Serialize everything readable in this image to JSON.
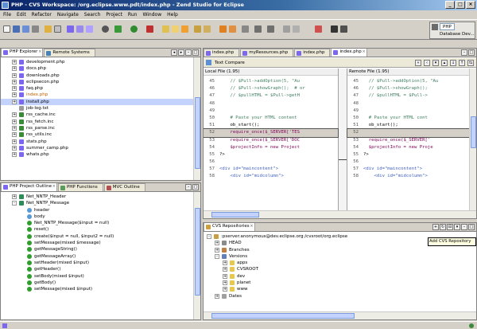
{
  "window": {
    "title": "PHP - CVS Workspace: /org.eclipse.www.pdt/index.php - Zend Studio for Eclipse",
    "buttons": [
      "_",
      "□",
      "×"
    ]
  },
  "menu": [
    "File",
    "Edit",
    "Refactor",
    "Navigate",
    "Search",
    "Project",
    "Run",
    "Window",
    "Help"
  ],
  "perspective": {
    "active": "PHP",
    "other": "Database Dev..."
  },
  "explorer": {
    "tabs": [
      "PHP Explorer",
      "Remote Systems"
    ],
    "items": [
      {
        "label": "development.php",
        "type": "php",
        "exp": true
      },
      {
        "label": "docs.php",
        "type": "php",
        "exp": true
      },
      {
        "label": "downloads.php",
        "type": "php",
        "exp": true
      },
      {
        "label": "eclipsecon.php",
        "type": "php",
        "exp": true
      },
      {
        "label": "faq.php",
        "type": "php",
        "exp": true
      },
      {
        "label": "index.php",
        "type": "php",
        "exp": true,
        "highlight": true
      },
      {
        "label": "install.php",
        "type": "php",
        "exp": true,
        "selected": true
      },
      {
        "label": "job-log.txt",
        "type": "txt",
        "exp": false
      },
      {
        "label": "rss_cache.inc",
        "type": "inc",
        "exp": true
      },
      {
        "label": "rss_fetch.inc",
        "type": "inc",
        "exp": true
      },
      {
        "label": "rss_parse.inc",
        "type": "inc",
        "exp": true
      },
      {
        "label": "rss_utils.inc",
        "type": "inc",
        "exp": true
      },
      {
        "label": "stats.php",
        "type": "php",
        "exp": true
      },
      {
        "label": "summer_camp.php",
        "type": "php",
        "exp": true
      },
      {
        "label": "whats.php",
        "type": "php",
        "exp": true
      }
    ]
  },
  "outline": {
    "tabs": [
      "PHP Project Outline",
      "PHP Functions",
      "MVC Outline"
    ],
    "items": [
      {
        "label": "Net_NNTP_Header",
        "depth": 0,
        "type": "class",
        "exp": "+"
      },
      {
        "label": "Net_NNTP_Message",
        "depth": 0,
        "type": "class",
        "exp": "-"
      },
      {
        "label": "header",
        "depth": 1,
        "type": "field"
      },
      {
        "label": "body",
        "depth": 1,
        "type": "field"
      },
      {
        "label": "Net_NNTP_Message($input = null)",
        "depth": 1,
        "type": "method"
      },
      {
        "label": "reset()",
        "depth": 1,
        "type": "method"
      },
      {
        "label": "create($input = null, $input2 = null)",
        "depth": 1,
        "type": "method"
      },
      {
        "label": "setMessage(mixed $message)",
        "depth": 1,
        "type": "method"
      },
      {
        "label": "getMessageString()",
        "depth": 1,
        "type": "method"
      },
      {
        "label": "getMessageArray()",
        "depth": 1,
        "type": "method"
      },
      {
        "label": "setHeader(mixed $input)",
        "depth": 1,
        "type": "method"
      },
      {
        "label": "getHeader()",
        "depth": 1,
        "type": "method"
      },
      {
        "label": "setBody(mixed $input)",
        "depth": 1,
        "type": "method"
      },
      {
        "label": "getBody()",
        "depth": 1,
        "type": "method"
      },
      {
        "label": "setMessage(mixed $input)",
        "depth": 1,
        "type": "method"
      }
    ]
  },
  "editor": {
    "tabs": [
      "index.php",
      "myResources.php",
      "index.php",
      "index.php"
    ],
    "compare_tab": "Text Compare",
    "local_label": "Local File (1.95)",
    "remote_label": "Remote File (1.95)",
    "left_lines": [
      {
        "n": "45",
        "t": "    // $Pull->addOption(5, \"Au"
      },
      {
        "n": "46",
        "t": "    // $Pull->showGraph();  # or"
      },
      {
        "n": "47",
        "t": "    // $pullHTML = $Pull->getH"
      },
      {
        "n": "48",
        "t": ""
      },
      {
        "n": "49",
        "t": ""
      },
      {
        "n": "50",
        "t": "    # Paste your HTML content"
      },
      {
        "n": "51",
        "t": "    ob_start();"
      },
      {
        "n": "52",
        "t": "    require_once($_SERVER['TES"
      },
      {
        "n": "53",
        "t": "    require_once($_SERVER['DOC"
      },
      {
        "n": "54",
        "t": "    $projectInfo = new Project"
      },
      {
        "n": "55",
        "t": "?>"
      },
      {
        "n": "56",
        "t": ""
      },
      {
        "n": "57",
        "t": "<div id=\"maincontent\">"
      },
      {
        "n": "58",
        "t": "    <div id=\"midcolumn\">"
      }
    ],
    "right_lines": [
      {
        "n": "45",
        "t": "  // $Pull->addOption(5, \"Au"
      },
      {
        "n": "46",
        "t": "  // $Pull->showGraph();"
      },
      {
        "n": "47",
        "t": "  // $pullHTML = $Pull->"
      },
      {
        "n": "48",
        "t": ""
      },
      {
        "n": "49",
        "t": ""
      },
      {
        "n": "50",
        "t": "  # Paste your HTML cont"
      },
      {
        "n": "51",
        "t": "  ob_start();"
      },
      {
        "n": "52",
        "t": ""
      },
      {
        "n": "53",
        "t": "  require_once($_SERVER['"
      },
      {
        "n": "54",
        "t": "  $projectInfo = new Proje"
      },
      {
        "n": "55",
        "t": "?>"
      },
      {
        "n": "56",
        "t": ""
      },
      {
        "n": "57",
        "t": "<div id=\"maincontent\">"
      },
      {
        "n": "58",
        "t": "    <div id=\"midcolumn\">"
      }
    ]
  },
  "cvs": {
    "tab": "CVS Repositories",
    "tooltip": "Add CVS Repository",
    "items": [
      {
        "label": ":pserver:anonymous@dev.eclipse.org:/cvsroot/org.eclipse",
        "depth": 0,
        "type": "repo",
        "exp": "-"
      },
      {
        "label": "HEAD",
        "depth": 1,
        "type": "head",
        "exp": "+"
      },
      {
        "label": "Branches",
        "depth": 1,
        "type": "branch",
        "exp": "+"
      },
      {
        "label": "Versions",
        "depth": 1,
        "type": "version",
        "exp": "-"
      },
      {
        "label": "apps",
        "depth": 2,
        "type": "folder",
        "exp": "+"
      },
      {
        "label": "CVSROOT",
        "depth": 2,
        "type": "folder",
        "exp": "+"
      },
      {
        "label": "dev",
        "depth": 2,
        "type": "folder",
        "exp": "+"
      },
      {
        "label": "planet",
        "depth": 2,
        "type": "folder",
        "exp": "+"
      },
      {
        "label": "www",
        "depth": 2,
        "type": "folder",
        "exp": "+"
      },
      {
        "label": "Dates",
        "depth": 1,
        "type": "date",
        "exp": "+"
      }
    ]
  },
  "colors": {
    "title_start": "#0a246a",
    "title_end": "#a6caf0",
    "diff_highlight": "#d4d0c8",
    "selection": "#c3d3fd",
    "php_icon": "#7b68ee",
    "inc_icon": "#3a8a3a",
    "folder_icon": "#e8c84a",
    "code_comment": "#3f7f5f",
    "code_keyword": "#7f0055"
  }
}
